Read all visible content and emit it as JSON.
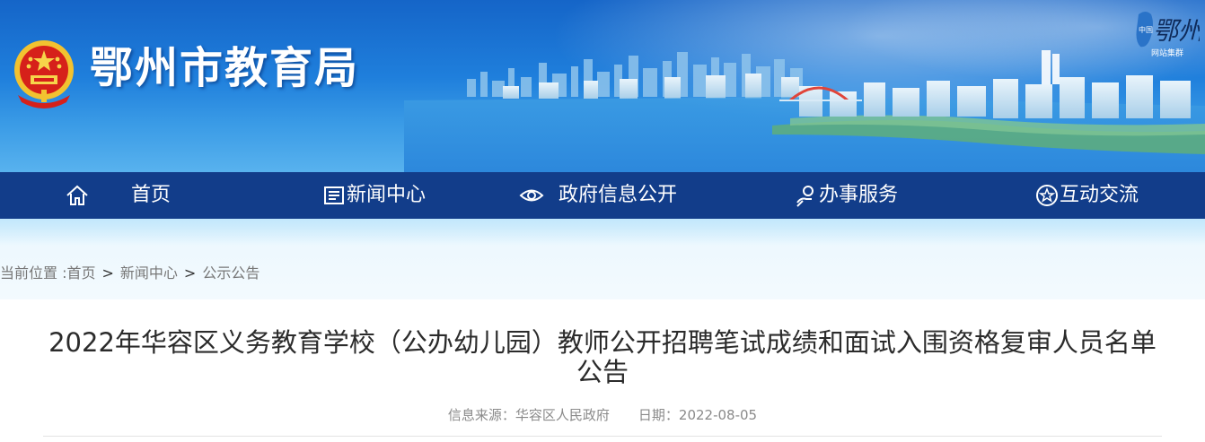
{
  "header": {
    "site_title": "鄂州市教育局",
    "corner_logo_text": "鄂州",
    "corner_logo_side": "中国",
    "corner_logo_sub": "网站集群"
  },
  "nav": {
    "items": [
      {
        "label": "首页",
        "icon": "home-icon"
      },
      {
        "label": "新闻中心",
        "icon": "newspaper-icon"
      },
      {
        "label": "政府信息公开",
        "icon": "eye-icon"
      },
      {
        "label": "办事服务",
        "icon": "service-icon"
      },
      {
        "label": "互动交流",
        "icon": "star-icon"
      }
    ]
  },
  "breadcrumb": {
    "prefix": "当前位置 :",
    "items": [
      "首页",
      "新闻中心",
      "公示公告"
    ],
    "separator": ">"
  },
  "article": {
    "title": "2022年华容区义务教育学校（公办幼儿园）教师公开招聘笔试成绩和面试入围资格复审人员名单公告",
    "source_label": "信息来源：",
    "source_value": "华容区人民政府",
    "date_label": "日期：",
    "date_value": "2022-08-05"
  },
  "colors": {
    "nav_bg": "#123d8a",
    "banner_top": "#1565c8",
    "title_text": "#2b2b2b",
    "meta_text": "#8a8a8a"
  }
}
